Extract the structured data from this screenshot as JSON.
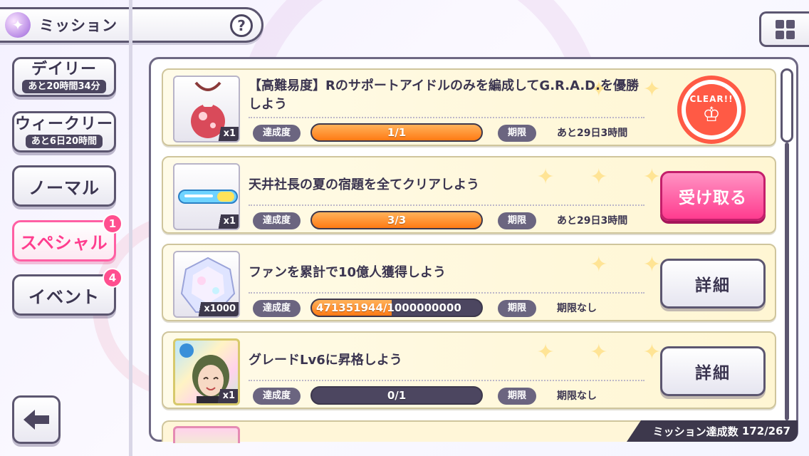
{
  "header": {
    "title": "ミッション",
    "help_label": "?"
  },
  "sidebar": {
    "tabs": [
      {
        "label": "デイリー",
        "sub": "あと20時間34分"
      },
      {
        "label": "ウィークリー",
        "sub": "あと6日20時間"
      },
      {
        "label": "ノーマル"
      },
      {
        "label": "スペシャル",
        "badge": "1",
        "selected": true
      },
      {
        "label": "イベント",
        "badge": "4"
      }
    ]
  },
  "labels": {
    "progress": "達成度",
    "deadline": "期限"
  },
  "missions": [
    {
      "title": "【高難易度】Rのサポートアイドルのみを編成してG.R.A.D.を優勝しよう",
      "qty": "x1",
      "progress_text": "1/1",
      "progress_ratio": 1.0,
      "deadline": "あと29日3時間",
      "status": "clear",
      "stamp_text": "CLEAR!!"
    },
    {
      "title": "天井社長の夏の宿題を全てクリアしよう",
      "qty": "x1",
      "progress_text": "3/3",
      "progress_ratio": 1.0,
      "deadline": "あと29日3時間",
      "status": "receive",
      "button_label": "受け取る"
    },
    {
      "title": "ファンを累計で10億人獲得しよう",
      "qty": "x1000",
      "progress_current": "471351944",
      "progress_total": "/1000000000",
      "progress_ratio": 0.471351944,
      "deadline": "期限なし",
      "status": "detail",
      "button_label": "詳細"
    },
    {
      "title": "グレードLv6に昇格しよう",
      "qty": "x1",
      "progress_text": "0/1",
      "progress_ratio": 0.0,
      "deadline": "期限なし",
      "status": "detail",
      "button_label": "詳細"
    }
  ],
  "footer": {
    "label": "ミッション達成数",
    "count": "172/267"
  },
  "colors": {
    "accent_pink": "#ff3c8f",
    "progress_orange": "#ff7a14",
    "clear_red": "#ff5a45",
    "frame": "#5c5670"
  }
}
